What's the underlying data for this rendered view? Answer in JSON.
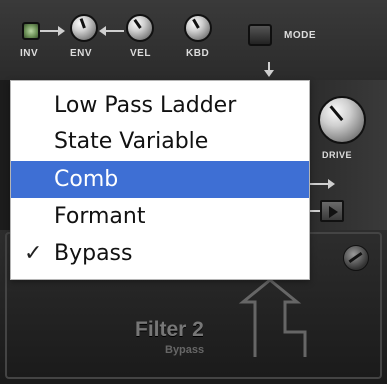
{
  "top_controls": {
    "inv_label": "INV",
    "env_label": "ENV",
    "vel_label": "VEL",
    "kbd_label": "KBD",
    "mode_label": "MODE"
  },
  "drive": {
    "label": "DRIVE"
  },
  "filter_panel": {
    "title": "Filter 2",
    "subtitle": "Bypass"
  },
  "filter_type_menu": {
    "items": [
      {
        "label": "Low Pass Ladder",
        "selected": false,
        "checked": false
      },
      {
        "label": "State Variable",
        "selected": false,
        "checked": false
      },
      {
        "label": "Comb",
        "selected": true,
        "checked": false
      },
      {
        "label": "Formant",
        "selected": false,
        "checked": false
      },
      {
        "label": "Bypass",
        "selected": false,
        "checked": true
      }
    ],
    "check_glyph": "✓"
  },
  "colors": {
    "menu_highlight": "#3e6fd4",
    "menu_background": "#ffffff",
    "panel": "#2b2b2b",
    "inv_led": "#8fb478"
  }
}
